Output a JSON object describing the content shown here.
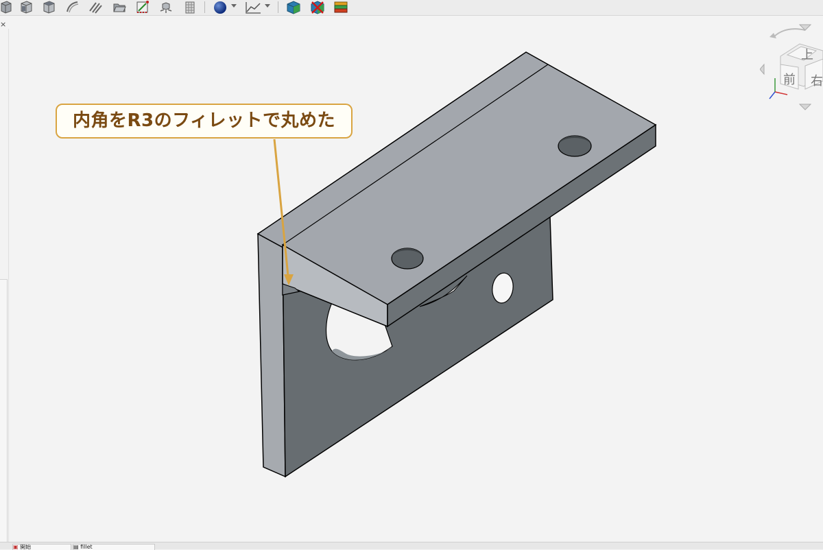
{
  "toolbar": {
    "buttons": [
      {
        "name": "view-fit-icon"
      },
      {
        "name": "view-box-front-icon"
      },
      {
        "name": "view-box-top-icon"
      },
      {
        "name": "curve-icon"
      },
      {
        "name": "hatch-icon"
      },
      {
        "name": "folder-open-icon"
      },
      {
        "name": "measure-icon"
      },
      {
        "name": "explode-icon"
      },
      {
        "name": "grid-icon"
      },
      {
        "name": "sphere-icon"
      },
      {
        "name": "graph-icon"
      },
      {
        "name": "cube-icon"
      },
      {
        "name": "cube-remove-icon"
      },
      {
        "name": "stack-icon"
      }
    ]
  },
  "viewport": {
    "close_label": "×"
  },
  "callout": {
    "text": "内角をR3のフィレットで丸めた",
    "border_color": "#d9a441",
    "text_color": "#7a4a12"
  },
  "navcube": {
    "top_label": "上",
    "front_label": "前",
    "right_label": "右"
  },
  "bottom_tabs": [
    {
      "label": "開始"
    },
    {
      "label": "fillet"
    }
  ]
}
